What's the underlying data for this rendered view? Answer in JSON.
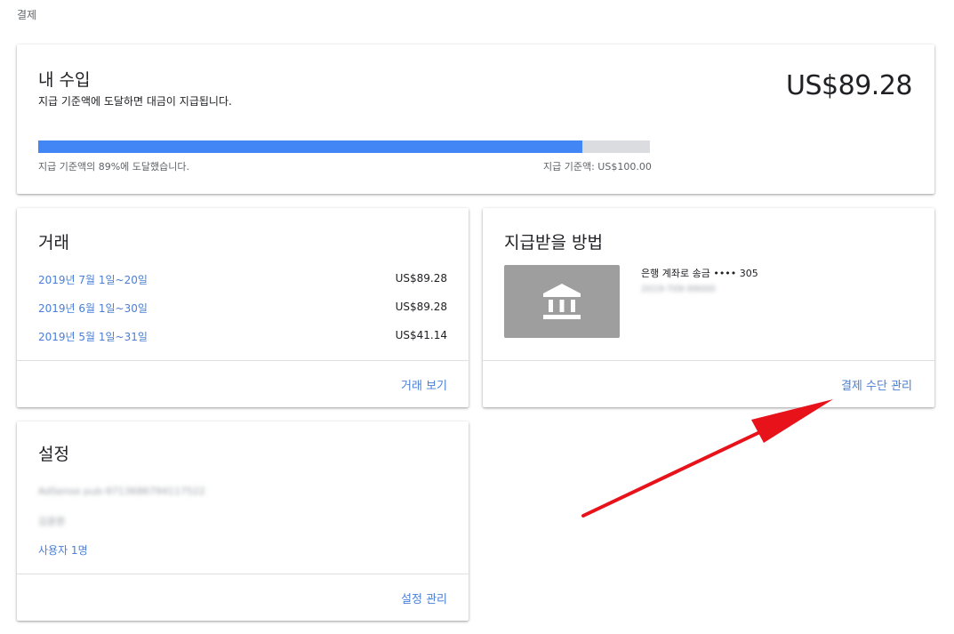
{
  "breadcrumb": "결제",
  "earnings": {
    "title": "내 수입",
    "subtitle": "지급 기준액에 도달하면 대금이 지급됩니다.",
    "amount": "US$89.28",
    "progress_percent": 89,
    "progress_text": "지급 기준액의 89%에 도달했습니다.",
    "threshold_text": "지급 기준액: US$100.00",
    "colors": {
      "fill": "#4285f4",
      "track": "#dadce0"
    }
  },
  "transactions": {
    "title": "거래",
    "rows": [
      {
        "date": "2019년 7월 1일~20일",
        "amount": "US$89.28"
      },
      {
        "date": "2019년 6월 1일~30일",
        "amount": "US$89.28"
      },
      {
        "date": "2019년 5월 1일~31일",
        "amount": "US$41.14"
      }
    ],
    "view_link": "거래 보기"
  },
  "payment": {
    "title": "지급받을 방법",
    "icon": "bank-icon",
    "method_label": "은행 계좌로 송금 •••• 305",
    "method_detail": "2019-709-99000",
    "manage_link": "결제 수단 관리"
  },
  "settings": {
    "title": "설정",
    "publisher_id": "AdSense pub-9713686794117522",
    "owner_name": "김윤환",
    "users_link": "사용자 1명",
    "manage_link": "설정 관리"
  },
  "annotation": {
    "arrow_color": "#e8121b"
  }
}
